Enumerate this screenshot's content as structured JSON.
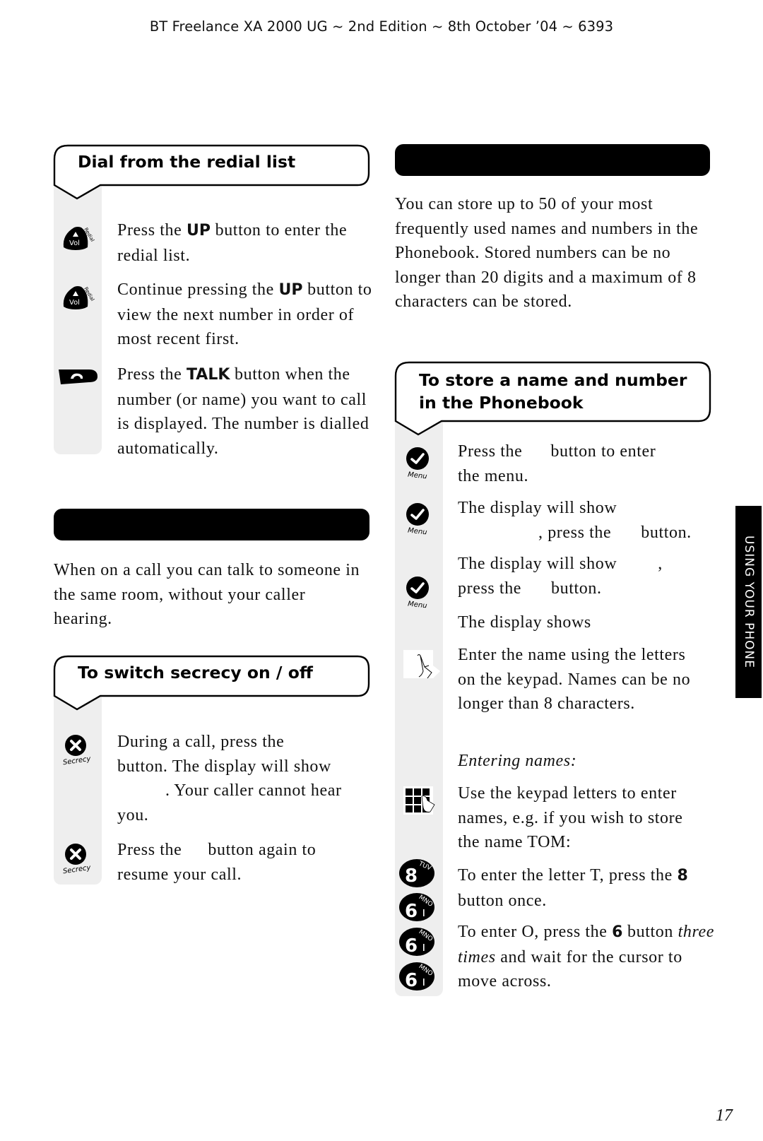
{
  "running_header": "BT Freelance XA 2000 UG ~ 2nd Edition ~ 8th October ’04 ~ 6393",
  "side_tab": "USING YOUR PHONE",
  "page_number": "17",
  "left_column": {
    "redial": {
      "title": "Dial from the redial list",
      "steps": [
        {
          "icon": "vol-redial-up-button-icon",
          "icon_label": "Vol",
          "icon_sub": "Redial",
          "pre": "Press the ",
          "kw": "UP",
          "post": " button to enter the redial list."
        },
        {
          "icon": "vol-redial-up-button-icon",
          "icon_label": "Vol",
          "icon_sub": "Redial",
          "pre": "Continue pressing the ",
          "kw": "UP",
          "post": " button to view the next number in order of most recent first."
        },
        {
          "icon": "talk-button-icon",
          "pre": "Press the ",
          "kw": "TALK",
          "post": " button when the number (or name) you want to call is displayed. The number is dialled automatically."
        }
      ]
    },
    "secrecy_section_bar": "",
    "secrecy_intro": "When on a call you can talk to someone in the same room, without your caller hearing.",
    "secrecy": {
      "title": "To switch secrecy on / off",
      "steps": [
        {
          "icon": "secrecy-button-icon",
          "icon_label": "Secrecy",
          "text_l1": "During a call, press the",
          "text_l2": "button. The display will show",
          "text_l3": ". Your caller cannot hear",
          "text_l4": "you."
        },
        {
          "icon": "secrecy-button-icon",
          "icon_label": "Secrecy",
          "text_l1": "Press the",
          "text_l1b": "button again to",
          "text_l2": "resume your call."
        }
      ]
    }
  },
  "right_column": {
    "phonebook_section_bar": "",
    "phonebook_intro": "You can store up to 50 of your most frequently used names and numbers in the Phonebook. Stored numbers can be no longer than 20 digits and a maximum of 8 characters can be stored.",
    "store": {
      "title": "To store a name and number in the Phonebook",
      "menu_label": "Menu",
      "steps": {
        "s1_a": "Press the",
        "s1_b": "button to enter",
        "s1_c": "the menu.",
        "s2_a": "The display will show",
        "s2_b": ", press the",
        "s2_c": "button.",
        "s3_a": "The display will show",
        "s3_b": ",",
        "s3_c": "press the",
        "s3_d": "button.",
        "s4": "The display shows",
        "s5": "Enter the name using the letters on the keypad. Names can be no longer than 8 characters.",
        "s6_heading": "Entering names:",
        "s7": "Use the keypad letters to enter names, e.g.  if you wish to store the name TOM:",
        "s8_pre": "To enter the letter T, press the ",
        "s8_kw": "8",
        "s8_post": " button once.",
        "s9_pre": "To enter O, press the ",
        "s9_kw": "6",
        "s9_mid_em": "three times",
        "s9_post": " and wait for the cursor to move across.",
        "s9_button_word": " button"
      },
      "keys": [
        {
          "digit": "8",
          "letters": "TUV"
        },
        {
          "digit": "6",
          "letters": "MNO"
        },
        {
          "digit": "6",
          "letters": "MNO"
        },
        {
          "digit": "6",
          "letters": "MNO"
        }
      ]
    }
  }
}
